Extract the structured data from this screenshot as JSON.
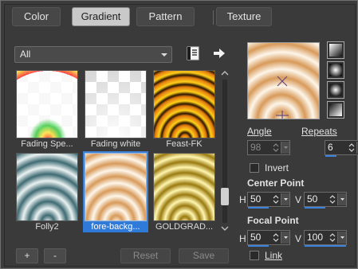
{
  "tabs": [
    {
      "label": "Color"
    },
    {
      "label": "Gradient"
    },
    {
      "label": "Pattern"
    },
    {
      "label": "Texture"
    }
  ],
  "active_tab": "Gradient",
  "category": {
    "selected": "All"
  },
  "toolbar_icons": [
    "gradient-file-icon",
    "export-arrow-icon"
  ],
  "gradients": [
    {
      "name": "Fading Spe..."
    },
    {
      "name": "Fading white"
    },
    {
      "name": "Feast-FK"
    },
    {
      "name": "Folly2"
    },
    {
      "name": "fore-backg..."
    },
    {
      "name": "GOLDGRAD..."
    }
  ],
  "selected_gradient": "fore-backg...",
  "bottom_buttons": {
    "add": "+",
    "remove": "-",
    "reset": "Reset",
    "save": "Save"
  },
  "style_buttons": [
    "linear-style-icon",
    "rectangular-style-icon",
    "sunburst-style-icon",
    "radial-style-icon"
  ],
  "angle": {
    "label": "Angle",
    "value": "98"
  },
  "repeats": {
    "label": "Repeats",
    "value": "6"
  },
  "invert": {
    "label": "Invert",
    "checked": false
  },
  "center_point": {
    "label": "Center Point",
    "h_label": "H",
    "h_value": "50",
    "v_label": "V",
    "v_value": "50"
  },
  "focal_point": {
    "label": "Focal Point",
    "h_label": "H",
    "h_value": "50",
    "v_label": "V",
    "v_value": "100"
  },
  "link": {
    "label": "Link",
    "checked": false
  },
  "colors": {
    "accent": "#3b83df",
    "panel": "#3a3a3a",
    "gradient_light": "#fdf6ea",
    "gradient_dark": "#d89a5a"
  }
}
